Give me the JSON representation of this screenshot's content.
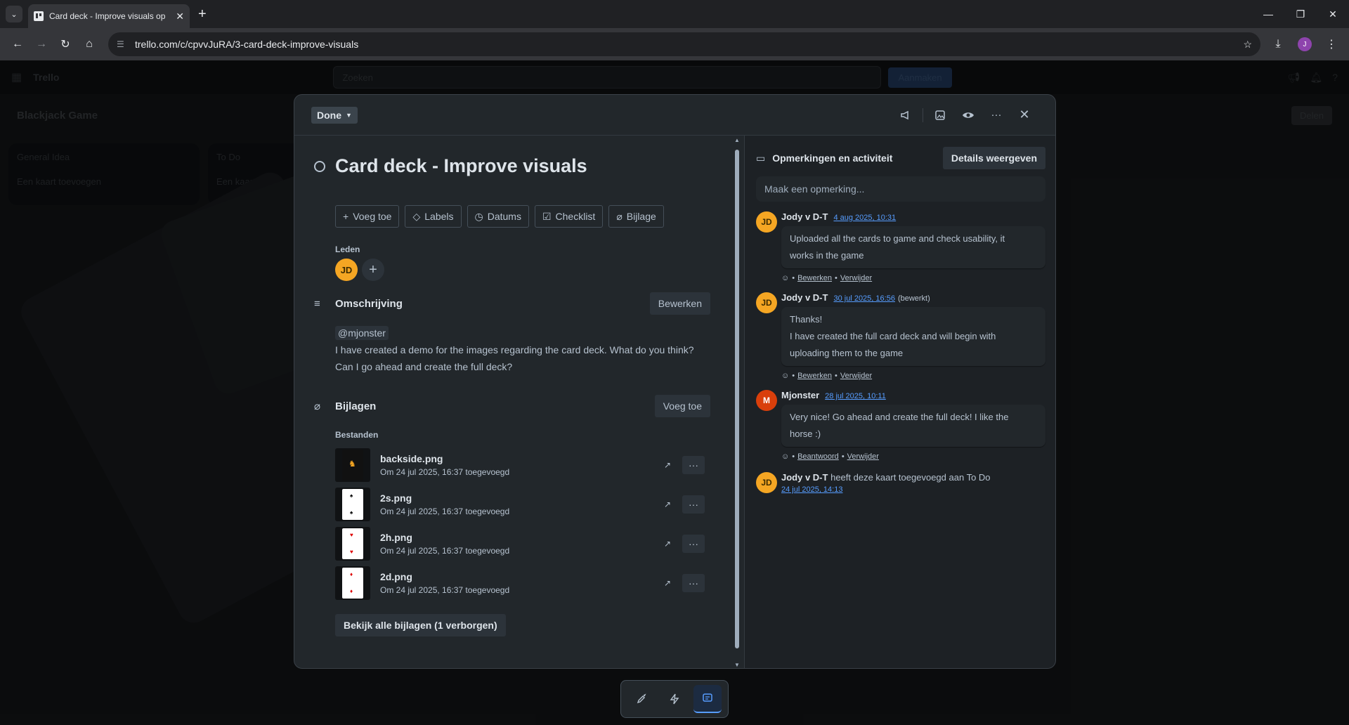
{
  "browser": {
    "tab_title": "Card deck - Improve visuals op",
    "url": "trello.com/c/cpvvJuRA/3-card-deck-improve-visuals",
    "profile_initial": "J"
  },
  "trello": {
    "app_name": "Trello",
    "search_placeholder": "Zoeken",
    "create_label": "Aanmaken",
    "board_title": "Blackjack Game",
    "share_label": "Delen",
    "lists": [
      {
        "name": "General Idea",
        "add_label": "Een kaart toevoegen"
      },
      {
        "name": "To Do",
        "add_label": "Een kaart toe"
      }
    ]
  },
  "card": {
    "status": "Done",
    "title": "Card deck - Improve visuals",
    "actions": {
      "add": "Voeg toe",
      "labels": "Labels",
      "dates": "Datums",
      "checklist": "Checklist",
      "attachment": "Bijlage"
    },
    "members_label": "Leden",
    "member_initials": "JD",
    "description": {
      "title": "Omschrijving",
      "edit_label": "Bewerken",
      "mention": "@mjonster",
      "line1": "I have created a demo for the images regarding the card deck. What do you think?",
      "line2": "Can I go ahead and create the full deck?"
    },
    "attachments": {
      "title": "Bijlagen",
      "add_label": "Voeg toe",
      "files_label": "Bestanden",
      "files": [
        {
          "name": "backside.png",
          "meta": "Om 24 jul 2025, 16:37 toegevoegd"
        },
        {
          "name": "2s.png",
          "meta": "Om 24 jul 2025, 16:37 toegevoegd"
        },
        {
          "name": "2h.png",
          "meta": "Om 24 jul 2025, 16:37 toegevoegd"
        },
        {
          "name": "2d.png",
          "meta": "Om 24 jul 2025, 16:37 toegevoegd"
        }
      ],
      "view_all": "Bekijk alle bijlagen (1 verborgen)"
    }
  },
  "activity": {
    "title": "Opmerkingen en activiteit",
    "details_label": "Details weergeven",
    "comment_placeholder": "Maak een opmerking...",
    "comments": [
      {
        "initials": "JD",
        "author": "Jody v D-T",
        "date": "4 aug 2025, 10:31",
        "edited": "",
        "lines": [
          "Uploaded all the cards to game and check usability, it",
          "works in the game"
        ],
        "link1": "Bewerken",
        "link2": "Verwijder"
      },
      {
        "initials": "JD",
        "author": "Jody v D-T",
        "date": "30 jul 2025, 16:56",
        "edited": "(bewerkt)",
        "lines": [
          "Thanks!",
          "I have created the full card deck and will begin with",
          "uploading them to the game"
        ],
        "link1": "Bewerken",
        "link2": "Verwijder"
      },
      {
        "initials": "M",
        "author": "Mjonster",
        "date": "28 jul 2025, 10:11",
        "edited": "",
        "lines": [
          "Very nice! Go ahead and create the full deck! I like the",
          "horse :)"
        ],
        "link1": "Beantwoord",
        "link2": "Verwijder"
      }
    ],
    "event": {
      "initials": "JD",
      "author": "Jody v D-T",
      "text": "heeft deze kaart toegevoegd aan To Do",
      "date": "24 jul 2025, 14:13"
    }
  },
  "colors": {
    "accent": "#579dff",
    "avatar_jd": "#f5a623",
    "avatar_m": "#d93f0b"
  }
}
